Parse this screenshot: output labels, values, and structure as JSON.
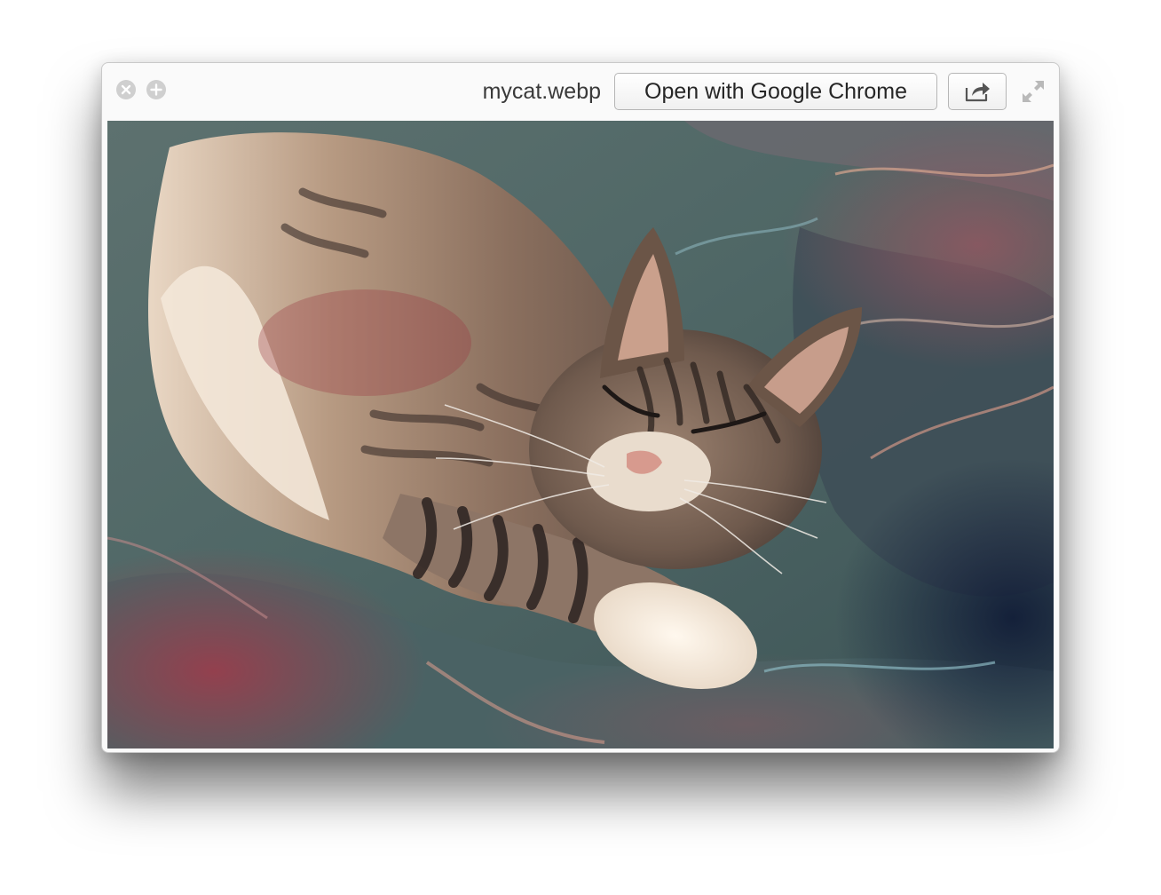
{
  "window": {
    "filename": "mycat.webp",
    "open_with_label": "Open with Google Chrome"
  },
  "icons": {
    "close": "close-circle-icon",
    "add": "add-circle-icon",
    "share": "share-icon",
    "fullscreen": "fullscreen-icon"
  },
  "preview": {
    "subject": "photo of a sleeping tabby cat lying on rumpled teal and red bedding"
  },
  "colors": {
    "window_bg": "#fafafa",
    "control_gray": "#cfcfcf",
    "text": "#3a3a3a"
  }
}
